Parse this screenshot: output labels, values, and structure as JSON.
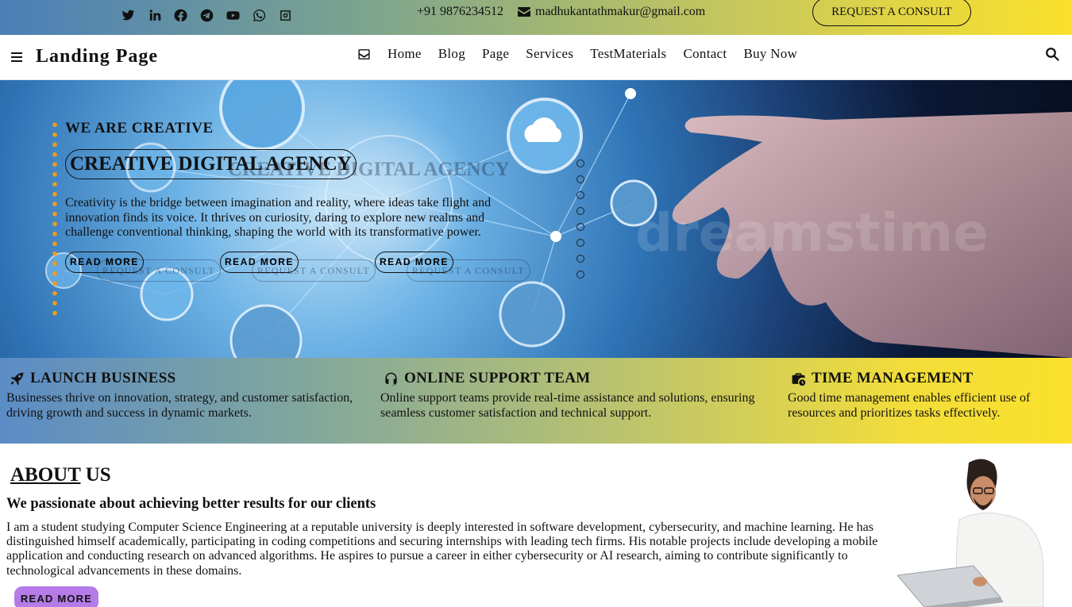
{
  "topbar": {
    "social_icons": [
      "twitter-icon",
      "linkedin-icon",
      "facebook-icon",
      "telegram-icon",
      "youtube-icon",
      "whatsapp-icon",
      "instagram-icon"
    ],
    "phone": "+91 9876234512",
    "email": "madhukantathmakur@gmail.com",
    "consult_button": "REQUEST A CONSULT"
  },
  "nav": {
    "brand": "Landing Page",
    "links": [
      "Home",
      "Blog",
      "Page",
      "Services",
      "TestMaterials",
      "Contact",
      "Buy Now"
    ]
  },
  "hero": {
    "eyebrow": "WE ARE CREATIVE",
    "headline": "CREATIVE DIGITAL AGENCY",
    "text": "Creativity is the bridge between imagination and reality, where ideas take flight and innovation finds its voice. It thrives on curiosity, daring to explore new realms and challenge conventional thinking, shaping the world with its transformative power.",
    "read_more": "READ MORE",
    "consult": "REQUEST A CONSULT",
    "image_watermark": "dreamstime"
  },
  "features": [
    {
      "icon": "rocket-icon",
      "title": "LAUNCH BUSINESS",
      "text": "Businesses thrive on innovation, strategy, and customer satisfaction, driving growth and success in dynamic markets."
    },
    {
      "icon": "headset-icon",
      "title": "ONLINE SUPPORT TEAM",
      "text": "Online support teams provide real-time assistance and solutions, ensuring seamless customer satisfaction and technical support."
    },
    {
      "icon": "business-time-icon",
      "title": "TIME MANAGEMENT",
      "text": "Good time management enables efficient use of resources and prioritizes tasks effectively."
    }
  ],
  "about": {
    "title_underlined": "ABOUT",
    "title_rest": " US",
    "subtitle": "We passionate about achieving better results for our clients",
    "text": "I am a student studying Computer Science Engineering at a reputable university is deeply interested in software development, cybersecurity, and machine learning. He has distinguished himself academically, participating in coding competitions and securing internships with leading tech firms. His notable projects include developing a mobile application and conducting research on advanced algorithms. He aspires to pursue a career in either cybersecurity or AI research, aiming to contribute significantly to technological advancements in these domains.",
    "button": "READ MORE"
  },
  "colors": {
    "gradient_start": "#4a7fb8",
    "gradient_end": "#fbe12c",
    "accent_orange": "#f39a1b",
    "button_purple": "#b57be8"
  }
}
